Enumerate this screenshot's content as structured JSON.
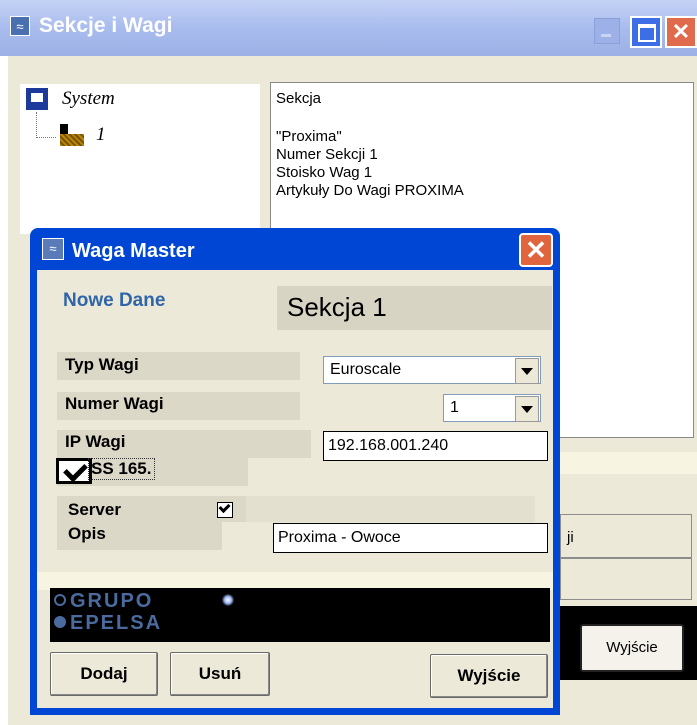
{
  "back_window": {
    "title": "Sekcje i Wagi",
    "tree": {
      "root_label": "System",
      "child_label": "1"
    },
    "info_lines": [
      "Sekcja",
      "",
      "\"Proxima\"",
      "Numer Sekcji 1",
      "Stoisko Wag 1",
      "Artykuły Do Wagi PROXIMA"
    ],
    "button_1_fragment": "ji",
    "exit_label": "Wyjście"
  },
  "dialog": {
    "title": "Waga Master",
    "heading": "Nowe Dane",
    "section_title": "Sekcja 1",
    "fields": {
      "typ_wagi": {
        "label": "Typ Wagi",
        "value": "Euroscale"
      },
      "numer_wagi": {
        "label": "Numer Wagi",
        "value": "1"
      },
      "ip_wagi": {
        "label": "IP Wagi",
        "value": "192.168.001.240"
      },
      "ss165": {
        "label": "SS 165.",
        "checked": true
      },
      "server": {
        "label": "Server",
        "checked": true
      },
      "opis": {
        "label": "Opis",
        "value": "Proxima - Owoce"
      }
    },
    "logo_lines": [
      "GRUPO",
      "EPELSA"
    ],
    "buttons": {
      "add": "Dodaj",
      "remove": "Usuń",
      "exit": "Wyjście"
    }
  },
  "colors": {
    "dialog_titlebar": "#0046d5",
    "back_titlebar": "#a9bcee",
    "window_face": "#ece9d8",
    "heading_blue": "#3065a8",
    "close_red": "#e0643e"
  },
  "icons": [
    "app-icon",
    "minimize-icon",
    "maximize-icon",
    "close-icon",
    "system-monitor-icon",
    "scale-icon",
    "checkbox-checked-icon",
    "dropdown-arrow-icon"
  ]
}
